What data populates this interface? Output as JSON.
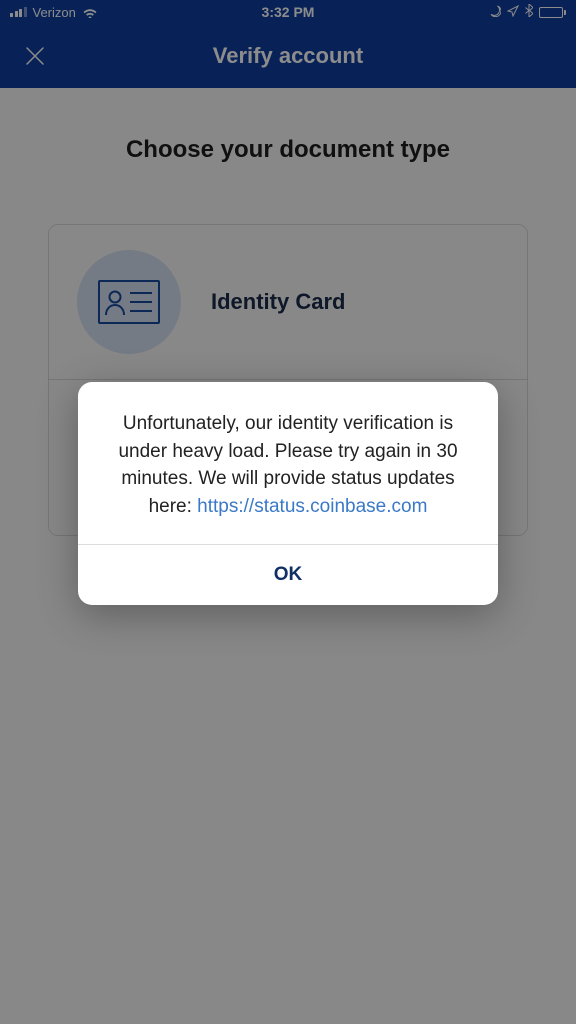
{
  "status_bar": {
    "carrier": "Verizon",
    "time": "3:32 PM"
  },
  "nav": {
    "title": "Verify account"
  },
  "main": {
    "heading": "Choose your document type",
    "documents": [
      {
        "label": "Identity Card"
      },
      {
        "label": ""
      }
    ]
  },
  "alert": {
    "message_prefix": "Unfortunately, our identity verification is under heavy load. Please try again in 30 minutes. We will provide status updates here: ",
    "link_text": "https://status.coinbase.com",
    "ok_label": "OK"
  }
}
